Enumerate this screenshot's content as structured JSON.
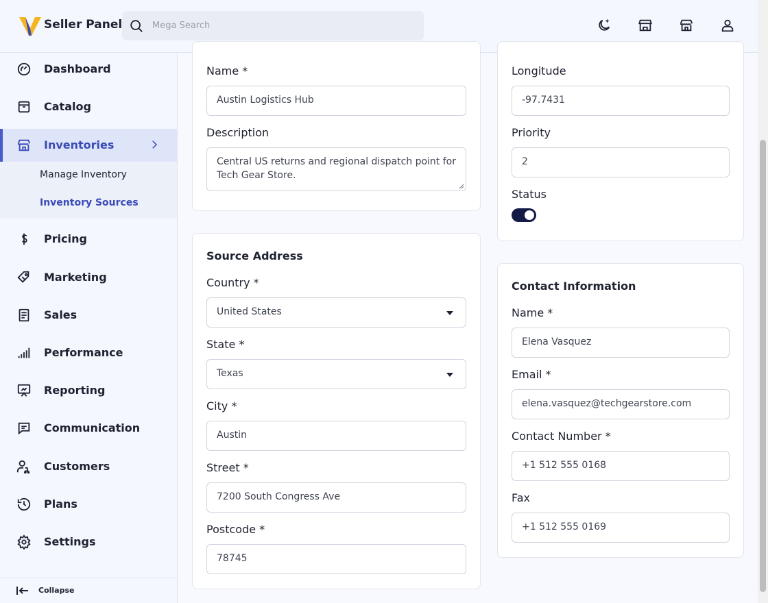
{
  "brand": {
    "name": "Seller Panel",
    "logo_icon": "v-logo-icon",
    "colors": {
      "primary": "#f5b51e",
      "accent": "#4a5ac8"
    }
  },
  "search": {
    "placeholder": "Mega Search"
  },
  "top_icons": [
    "moon-icon",
    "store-icon",
    "shop-icon",
    "user-icon"
  ],
  "sidebar": {
    "items": [
      {
        "label": "Dashboard",
        "icon": "gauge-icon"
      },
      {
        "label": "Catalog",
        "icon": "box-icon"
      },
      {
        "label": "Inventories",
        "icon": "warehouse-icon",
        "active": true
      },
      {
        "label": "Pricing",
        "icon": "dollar-icon"
      },
      {
        "label": "Marketing",
        "icon": "tag-icon"
      },
      {
        "label": "Sales",
        "icon": "document-icon"
      },
      {
        "label": "Performance",
        "icon": "signal-icon"
      },
      {
        "label": "Reporting",
        "icon": "presentation-icon"
      },
      {
        "label": "Communication",
        "icon": "chat-icon"
      },
      {
        "label": "Customers",
        "icon": "customers-icon"
      },
      {
        "label": "Plans",
        "icon": "history-icon"
      },
      {
        "label": "Settings",
        "icon": "gear-icon"
      }
    ],
    "sub_items": [
      {
        "label": "Manage Inventory"
      },
      {
        "label": "Inventory Sources",
        "active": true
      }
    ],
    "collapse_label": "Collapse"
  },
  "general": {
    "name_label": "Name",
    "name_value": "Austin Logistics Hub",
    "description_label": "Description",
    "description_value": "Central US returns and regional dispatch point for Tech Gear Store."
  },
  "address": {
    "title": "Source Address",
    "country_label": "Country",
    "country_value": "United States",
    "state_label": "State",
    "state_value": "Texas",
    "city_label": "City",
    "city_value": "Austin",
    "street_label": "Street",
    "street_value": "7200 South Congress Ave",
    "postcode_label": "Postcode",
    "postcode_value": "78745"
  },
  "location": {
    "longitude_label": "Longitude",
    "longitude_value": "-97.7431",
    "priority_label": "Priority",
    "priority_value": "2",
    "status_label": "Status",
    "status_on": true
  },
  "contact": {
    "title": "Contact Information",
    "name_label": "Name",
    "name_value": "Elena Vasquez",
    "email_label": "Email",
    "email_value": "elena.vasquez@techgearstore.com",
    "phone_label": "Contact Number",
    "phone_value": "+1 512 555 0168",
    "fax_label": "Fax",
    "fax_value": "+1 512 555 0169"
  },
  "required_mark": "*"
}
